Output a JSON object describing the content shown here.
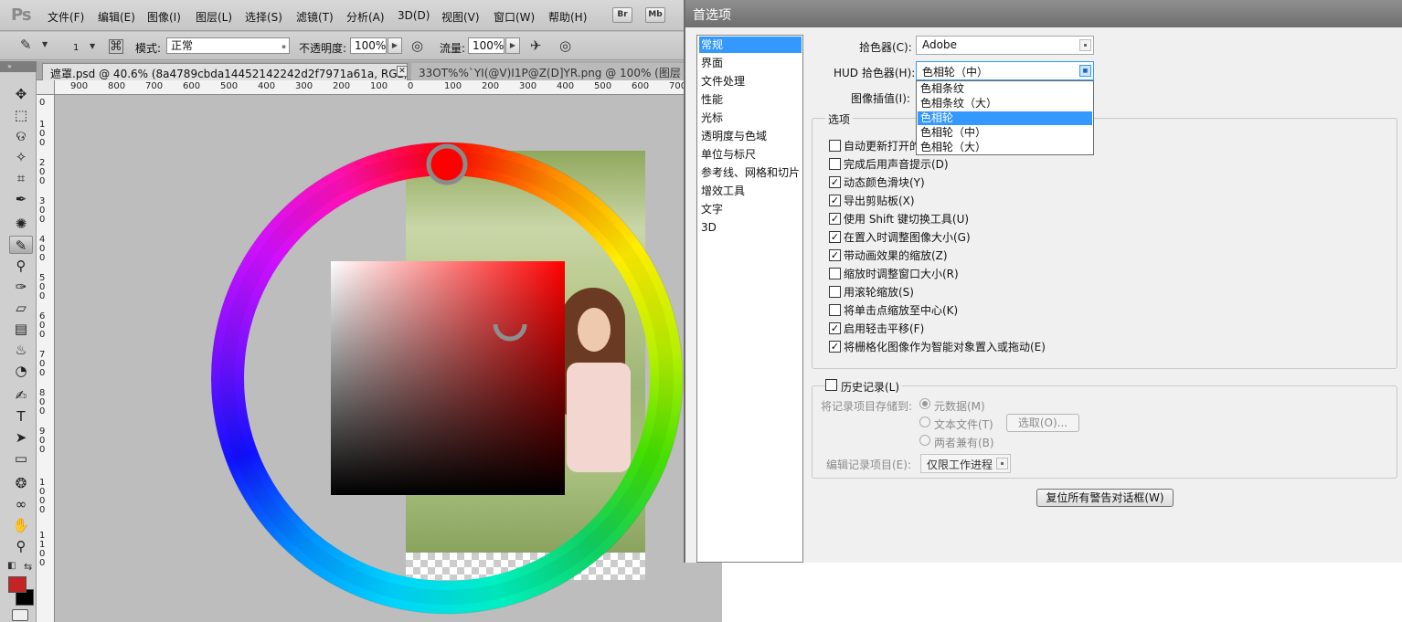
{
  "ps": {
    "logo": "Ps",
    "menus": [
      "文件(F)",
      "编辑(E)",
      "图像(I)",
      "图层(L)",
      "选择(S)",
      "滤镜(T)",
      "分析(A)",
      "3D(D)",
      "视图(V)",
      "窗口(W)",
      "帮助(H)"
    ],
    "bridge_buttons": [
      "Br",
      "Mb"
    ],
    "options": {
      "brush_size": "1",
      "mode_label": "模式:",
      "mode_value": "正常",
      "opacity_label": "不透明度:",
      "opacity_value": "100%",
      "flow_label": "流量:",
      "flow_value": "100%"
    },
    "tabs": [
      "遮罩.psd @ 40.6% (8a4789cbda14452142242d2f7971a61a, RGB/8) *",
      "33OT%%`YI(@V)I1P@Z(D]YR.png @ 100% (图层 0, RG"
    ],
    "ruler_h": [
      "900",
      "800",
      "700",
      "600",
      "500",
      "400",
      "300",
      "200",
      "100",
      "0",
      "100",
      "200",
      "300",
      "400",
      "500",
      "600",
      "700"
    ],
    "ruler_v": [
      "0",
      "1\n0\n0",
      "2\n0\n0",
      "3\n0\n0",
      "4\n0\n0",
      "5\n0\n0",
      "6\n0\n0",
      "7\n0\n0",
      "8\n0\n0",
      "9\n0\n0",
      "1\n0\n0\n0",
      "1\n1\n0\n0"
    ],
    "foreground_color": "#c42424",
    "background_color": "#000000"
  },
  "dialog": {
    "title": "首选项",
    "categories": [
      "常规",
      "界面",
      "文件处理",
      "性能",
      "光标",
      "透明度与色域",
      "单位与标尺",
      "参考线、网格和切片",
      "增效工具",
      "文字",
      "3D"
    ],
    "selected_category": "常规",
    "color_picker_label": "拾色器(C):",
    "color_picker_value": "Adobe",
    "hud_label": "HUD 拾色器(H):",
    "hud_value": "色相轮（中）",
    "interp_label": "图像插值(I):",
    "hud_options": [
      "色相条纹",
      "色相条纹（大）",
      "色相轮",
      "色相轮（中）",
      "色相轮（大）"
    ],
    "hud_highlight": "色相轮",
    "options_title": "选项",
    "checkboxes": [
      {
        "label": "自动更新打开的文档(A)",
        "checked": false
      },
      {
        "label": "完成后用声音提示(D)",
        "checked": false
      },
      {
        "label": "动态颜色滑块(Y)",
        "checked": true
      },
      {
        "label": "导出剪贴板(X)",
        "checked": true
      },
      {
        "label": "使用 Shift 键切换工具(U)",
        "checked": true
      },
      {
        "label": "在置入时调整图像大小(G)",
        "checked": true
      },
      {
        "label": "带动画效果的缩放(Z)",
        "checked": true
      },
      {
        "label": "缩放时调整窗口大小(R)",
        "checked": false
      },
      {
        "label": "用滚轮缩放(S)",
        "checked": false
      },
      {
        "label": "将单击点缩放至中心(K)",
        "checked": false
      },
      {
        "label": "启用轻击平移(F)",
        "checked": true
      },
      {
        "label": "将栅格化图像作为智能对象置入或拖动(E)",
        "checked": true
      }
    ],
    "history_label": "历史记录(L)",
    "history_save_label": "将记录项目存储到:",
    "radio_meta": "元数据(M)",
    "radio_text": "文本文件(T)",
    "choose_button": "选取(O)...",
    "radio_both": "两者兼有(B)",
    "edit_log_label": "编辑记录项目(E):",
    "edit_log_value": "仅限工作进程",
    "reset_button": "复位所有警告对话框(W)"
  }
}
